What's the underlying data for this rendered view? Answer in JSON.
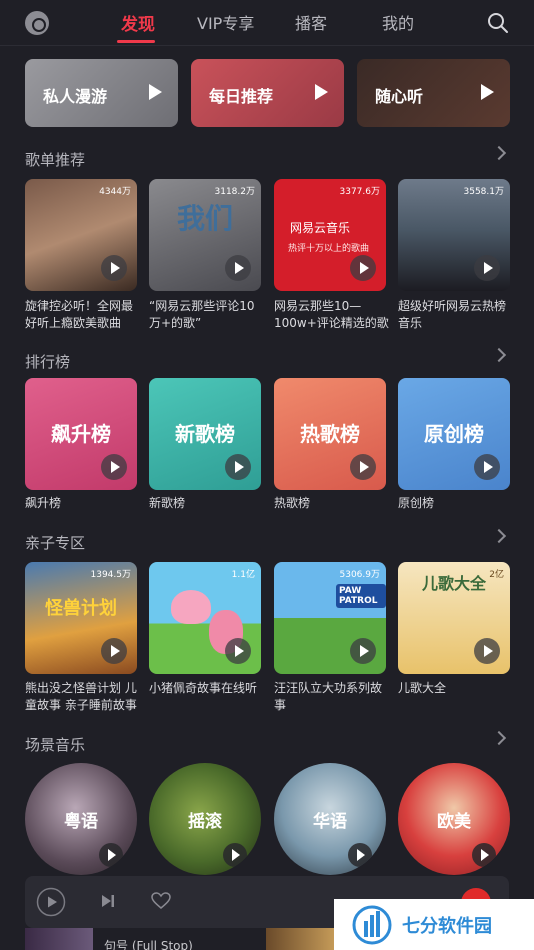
{
  "header": {
    "tabs": [
      {
        "label": "发现",
        "active": true
      },
      {
        "label": "VIP专享",
        "active": false
      },
      {
        "label": "播客",
        "active": false
      },
      {
        "label": "我的",
        "active": false
      }
    ]
  },
  "quick_actions": [
    {
      "label": "私人漫游"
    },
    {
      "label": "每日推荐"
    },
    {
      "label": "随心听"
    }
  ],
  "playlist_section": {
    "title": "歌单推荐",
    "items": [
      {
        "count": "4344万",
        "caption": "旋律控必听！全网最好听上瘾欧美歌曲"
      },
      {
        "count": "3118.2万",
        "caption": "“网易云那些评论10万+的歌”",
        "cover_text": "我们"
      },
      {
        "count": "3377.6万",
        "caption": "网易云那些10—100w+评论精选的歌",
        "cover_brand": "网易云音乐",
        "cover_sub": "热评十万以上的歌曲"
      },
      {
        "count": "3558.1万",
        "caption": "超级好听网易云热榜音乐"
      }
    ]
  },
  "chart_section": {
    "title": "排行榜",
    "items": [
      {
        "cover_text": "飙升榜",
        "caption": "飙升榜"
      },
      {
        "cover_text": "新歌榜",
        "caption": "新歌榜"
      },
      {
        "cover_text": "热歌榜",
        "caption": "热歌榜"
      },
      {
        "cover_text": "原创榜",
        "caption": "原创榜"
      }
    ]
  },
  "kids_section": {
    "title": "亲子专区",
    "items": [
      {
        "count": "1394.5万",
        "caption": "熊出没之怪兽计划 儿童故事 亲子睡前故事",
        "cover_text": "怪兽计划"
      },
      {
        "count": "1.1亿",
        "caption": "小猪佩奇故事在线听"
      },
      {
        "count": "5306.9万",
        "caption": "汪汪队立大功系列故事",
        "cover_text": "PAW PATROL"
      },
      {
        "count": "2亿",
        "caption": "儿歌大全",
        "cover_text": "儿歌大全"
      }
    ]
  },
  "scene_section": {
    "title": "场景音乐",
    "items": [
      {
        "label": "粤语"
      },
      {
        "label": "摇滚"
      },
      {
        "label": "华语"
      },
      {
        "label": "欧美"
      }
    ]
  },
  "mini_player": {
    "song": "句号 (Full Stop)"
  },
  "watermark": {
    "text": "七分软件园"
  },
  "colors": {
    "accent": "#f0394a",
    "background": "#1f1f26"
  }
}
